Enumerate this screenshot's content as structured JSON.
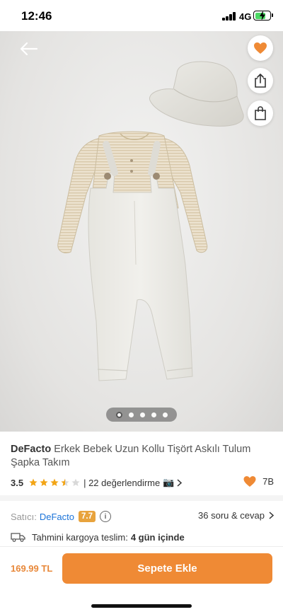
{
  "status_bar": {
    "time": "12:46",
    "network": "4G"
  },
  "product": {
    "brand": "DeFacto",
    "name": " Erkek Bebek Uzun Kollu Tişört Askılı Tulum Şapka Takım",
    "rating": "3.5",
    "rating_stars": 3.5,
    "reviews": "| 22 değerlendirme",
    "camera": "📷",
    "favorites": "7B"
  },
  "gallery": {
    "image_count": 5,
    "active_index": 0
  },
  "seller": {
    "label": "Satıcı:",
    "name": "DeFacto",
    "score": "7.7",
    "info": "i",
    "qa_link": "36 soru & cevap"
  },
  "delivery": {
    "label": "Tahmini kargoya teslim:",
    "value": "4 gün içinde"
  },
  "purchase": {
    "price": "169.99 TL",
    "button_label": "Sepete Ekle"
  },
  "colors": {
    "accent": "#ef8a35",
    "link": "#1a73d9",
    "seller_badge": "#e8a33d"
  }
}
